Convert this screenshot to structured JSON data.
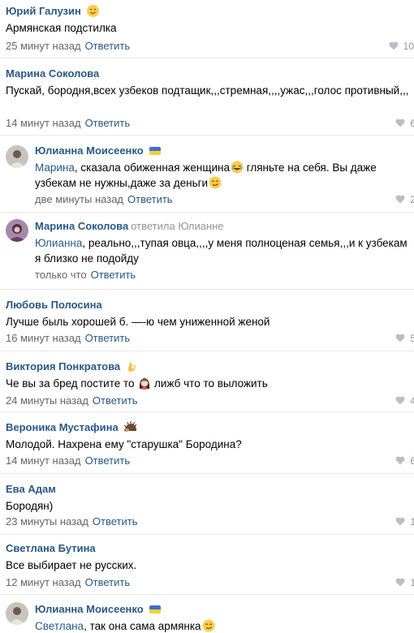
{
  "comments": [
    {
      "author": "Юрий Галузин",
      "author_emoji": "smiling-face-icon",
      "text_parts": [
        {
          "text": "Армянская подстилка"
        }
      ],
      "time": "25 минут назад",
      "reply_label": "Ответить",
      "likes": "10"
    },
    {
      "author": "Марина Соколова",
      "text_parts": [
        {
          "text": "Пускай, бородня,всех узбеков подтащик,,,стремная,,,,ужас,,,голос противный,,,"
        }
      ],
      "time": "14 минут назад",
      "reply_label": "Ответить",
      "likes": "6"
    },
    {
      "author": "Юлианна Моисеенко",
      "author_flag": "ukraine-flag-icon",
      "text_parts": [
        {
          "text": "Марина",
          "mention": true
        },
        {
          "text": ", сказала обиженная женщина"
        },
        {
          "emoji": "rolling-laughing-face-icon"
        },
        {
          "text": " гляньте на себя. Вы даже узбекам не нужны,даже за деньги"
        },
        {
          "emoji": "smirking-face-icon"
        }
      ],
      "time": "две минуты назад",
      "reply_label": "Ответить",
      "likes": "2"
    },
    {
      "author": "Марина Соколова",
      "replied_to": "ответила Юлианне",
      "text_parts": [
        {
          "text": "Юлианна",
          "mention": true
        },
        {
          "text": ", реально,,,тупая овца,,,,у меня полноценая семья,,,и к узбекам я близко не подойду"
        }
      ],
      "time": "только что",
      "reply_label": "Ответить",
      "likes": ""
    },
    {
      "author": "Любовь Полосина",
      "text_parts": [
        {
          "text": "Лучше быль хорошей б. —-ю чем униженной женой"
        }
      ],
      "time": "16 минут назад",
      "reply_label": "Ответить",
      "likes": "5"
    },
    {
      "author": "Виктория Понкратова",
      "author_emoji": "ok-hand-icon",
      "text_parts": [
        {
          "text": "Че вы за бред постите то "
        },
        {
          "emoji": "woman-icon"
        },
        {
          "text": " лижб что то выложить"
        }
      ],
      "time": "24 минуты назад",
      "reply_label": "Ответить",
      "likes": "4"
    },
    {
      "author": "Вероника Мустафина",
      "author_emoji": "hedgehog-icon",
      "text_parts": [
        {
          "text": "Молодой. Нахрена ему \"старушка\" Бородина?"
        }
      ],
      "time": "14 минут назад",
      "reply_label": "Ответить",
      "likes": "6"
    },
    {
      "author": "Ева Адам",
      "text_parts": [
        {
          "text": "Бородян)"
        }
      ],
      "time": "23 минуты назад",
      "reply_label": "Ответить",
      "likes": "1"
    },
    {
      "author": "Светлана Бутина",
      "text_parts": [
        {
          "text": "Все выбирает не русских."
        }
      ],
      "time": "12 минут назад",
      "reply_label": "Ответить",
      "likes": "1"
    },
    {
      "author": "Юлианна Моисеенко",
      "author_flag": "ukraine-flag-icon",
      "text_parts": [
        {
          "text": "Светлана",
          "mention": true
        },
        {
          "text": ", так она сама армянка"
        },
        {
          "emoji": "smirking-face-icon"
        }
      ],
      "time": "",
      "reply_label": "",
      "likes": ""
    }
  ],
  "colors": {
    "link": "#2a5885",
    "meta": "#656565",
    "divider": "#e7e8ec",
    "flag_blue": "#3a6fd8",
    "flag_yellow": "#f5d327"
  }
}
